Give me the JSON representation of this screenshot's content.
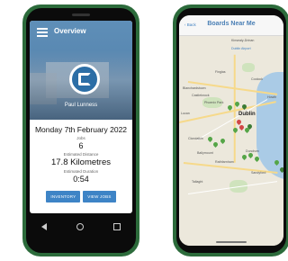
{
  "overview_screen": {
    "title": "Overview",
    "user_name": "Paul Lunness",
    "date": "Monday 7th February 2022",
    "jobs_label": "Jobs",
    "jobs_value": "6",
    "distance_label": "Estimated Distance",
    "distance_value": "17.8 Kilometres",
    "duration_label": "Estimated Duration",
    "duration_value": "0:54",
    "buttons": {
      "inventory": "INVENTORY",
      "view_jobs": "VIEW JOBS"
    }
  },
  "map_screen": {
    "back_label": "‹ Back",
    "title": "Boards Near Me",
    "city_label": "Dublin",
    "places": [
      "Kinsealy-Drinan",
      "Dublin Airport",
      "Finglas",
      "Coolock",
      "Clondalkin",
      "Tallaght",
      "Dundrum",
      "Blanchardstown",
      "Lucan",
      "Howth",
      "Phoenix Park",
      "Rathfarnham",
      "Sandyford",
      "Ballymount",
      "Castleknock"
    ]
  },
  "colors": {
    "phone_case": "#2c6b3b",
    "header_blue": "#4d7ba6",
    "button_blue": "#3e84c6",
    "map_title": "#4a7fb5",
    "pin_green": "#55a547",
    "pin_red": "#d04646"
  }
}
